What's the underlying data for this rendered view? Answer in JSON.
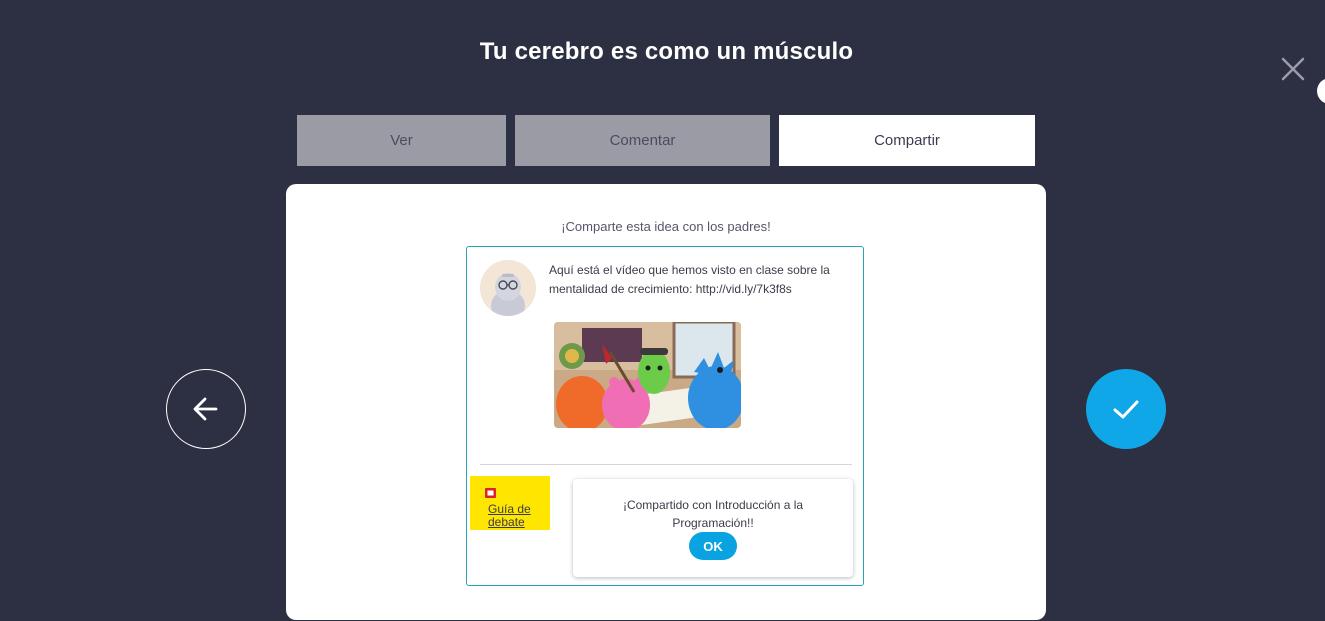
{
  "header": {
    "title": "Tu cerebro es como un músculo",
    "close_icon": "close-icon"
  },
  "tabs": [
    {
      "label": "Ver",
      "active": false
    },
    {
      "label": "Comentar",
      "active": false
    },
    {
      "label": "Compartir",
      "active": true
    }
  ],
  "share": {
    "prompt": "¡Comparte esta idea con los padres!",
    "message": "Aquí está el vídeo que hemos visto en clase sobre la mentalidad de crecimiento: http://vid.ly/7k3f8s",
    "guide_link": "Guía de debate",
    "toast_text": "¡Compartido con Introducción a la Programación!!",
    "ok_label": "OK"
  },
  "navigation": {
    "back_icon": "arrow-left-icon",
    "confirm_icon": "checkmark-icon"
  },
  "colors": {
    "background": "#2d2f42",
    "accent": "#10a7e8",
    "card_border": "#29a3b8",
    "guide_highlight": "#ffe600"
  }
}
